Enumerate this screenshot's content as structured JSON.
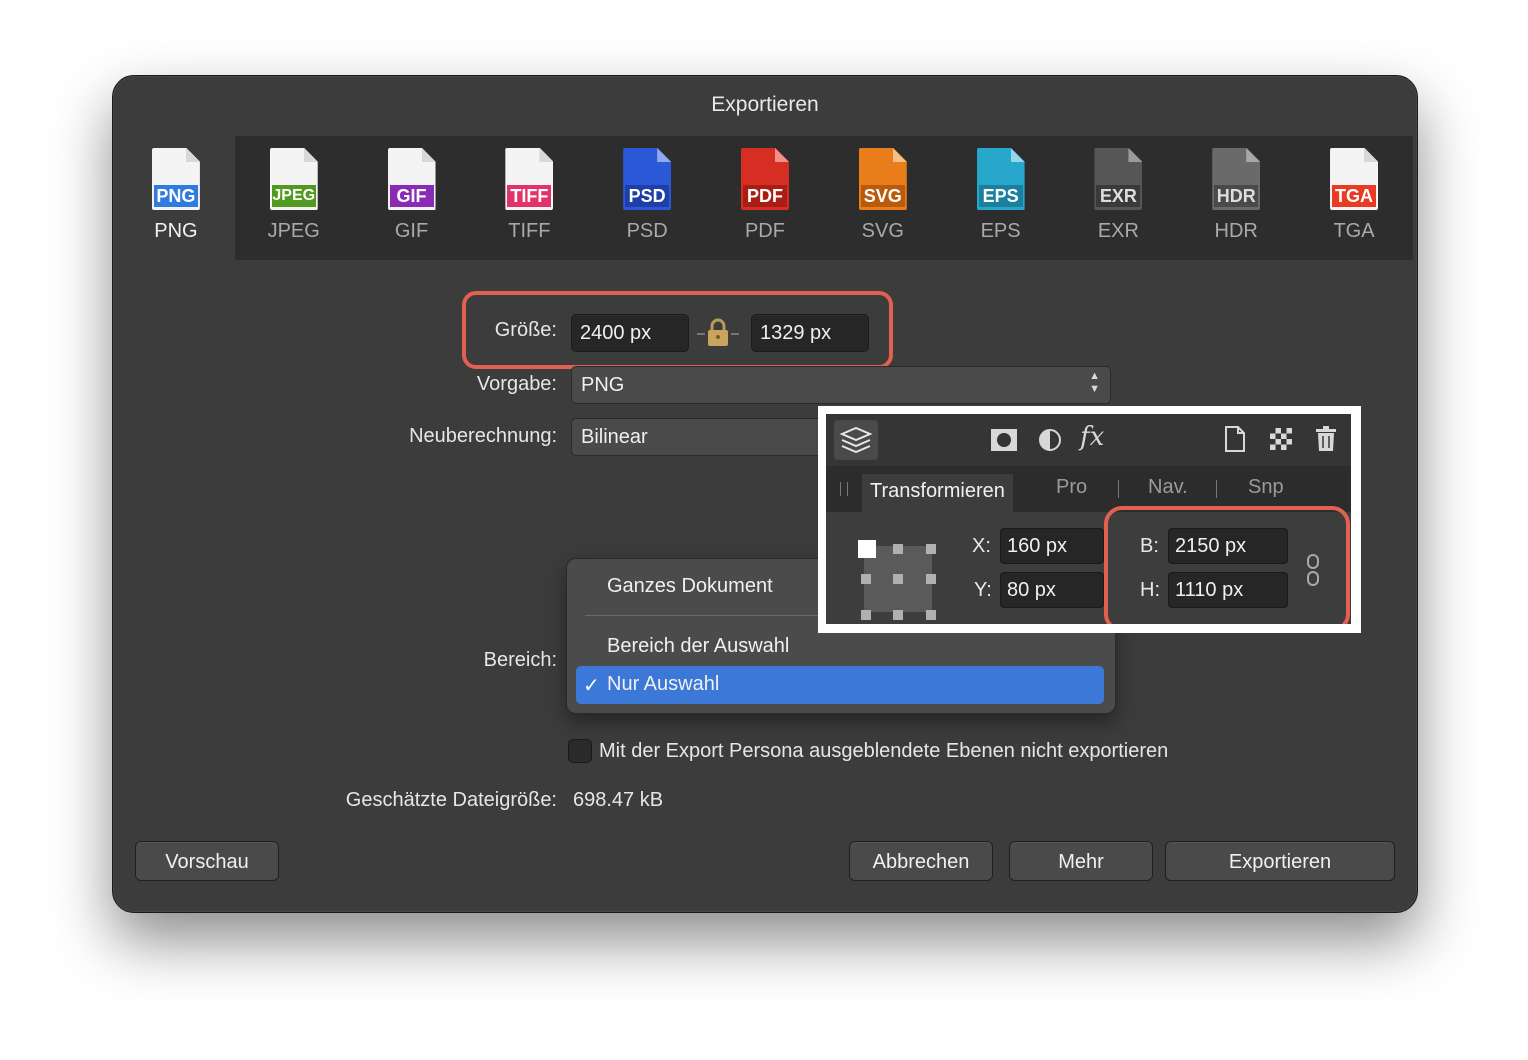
{
  "dialog": {
    "title": "Exportieren"
  },
  "formats": [
    {
      "tag": "PNG",
      "label": "PNG",
      "color": "#2f7be0"
    },
    {
      "tag": "JPEG",
      "label": "JPEG",
      "color": "#4f9a1f"
    },
    {
      "tag": "GIF",
      "label": "GIF",
      "color": "#8b2bb5"
    },
    {
      "tag": "TIFF",
      "label": "TIFF",
      "color": "#e2326a"
    },
    {
      "tag": "PSD",
      "label": "PSD",
      "color": "#2a58d6"
    },
    {
      "tag": "PDF",
      "label": "PDF",
      "color": "#d62e22"
    },
    {
      "tag": "SVG",
      "label": "SVG",
      "color": "#e87d19"
    },
    {
      "tag": "EPS",
      "label": "EPS",
      "color": "#27a7cc"
    },
    {
      "tag": "EXR",
      "label": "EXR",
      "color": "#565656"
    },
    {
      "tag": "HDR",
      "label": "HDR",
      "color": "#6a6a6a"
    },
    {
      "tag": "TGA",
      "label": "TGA",
      "color": "#ea3a22"
    }
  ],
  "form": {
    "size_label": "Größe:",
    "width": "2400 px",
    "height": "1329 px",
    "preset_label": "Vorgabe:",
    "preset_value": "PNG",
    "resample_label": "Neuberechnung:",
    "resample_value": "Bilinear",
    "area_label": "Bereich:",
    "area_options": [
      "Ganzes Dokument",
      "Bereich der Auswahl",
      "Nur Auswahl"
    ],
    "area_checkmark": "✓",
    "hidden_layers_label": "Mit der Export Persona ausgeblendete Ebenen nicht exportieren",
    "filesize_label": "Geschätzte Dateigröße:",
    "filesize_value": "698.47 kB"
  },
  "buttons": {
    "preview": "Vorschau",
    "cancel": "Abbrechen",
    "more": "Mehr",
    "export": "Exportieren"
  },
  "panel": {
    "tabs": [
      "Transformieren",
      "Pro",
      "Nav.",
      "Snp"
    ],
    "x_label": "X:",
    "x_value": "160 px",
    "y_label": "Y:",
    "y_value": "80 px",
    "w_label": "B:",
    "w_value": "2150 px",
    "h_label": "H:",
    "h_value": "1110 px",
    "fx": "fx"
  },
  "colors": {
    "highlight": "#e2604f",
    "selection": "#3b78d8"
  }
}
